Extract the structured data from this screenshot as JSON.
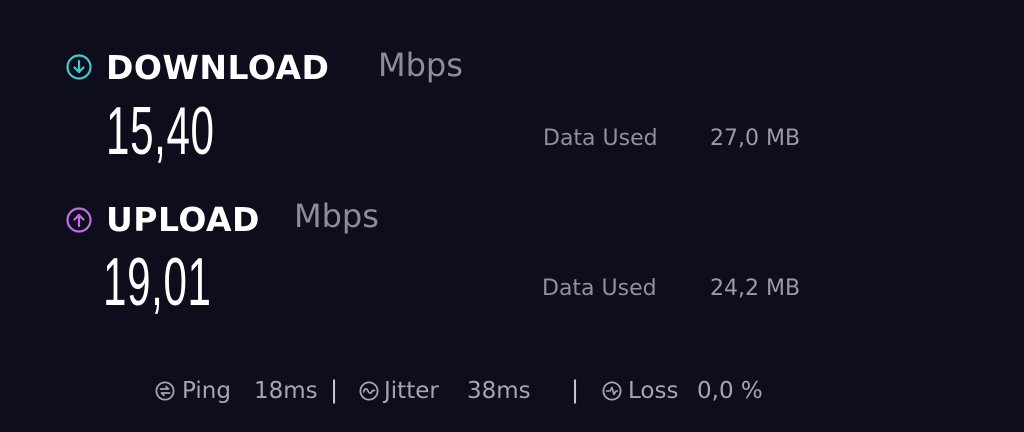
{
  "colors": {
    "background": "#0e0d1c",
    "download_accent": "#45c8cd",
    "upload_accent": "#c06ee6",
    "muted_text": "#8d8c9e"
  },
  "download": {
    "icon": "arrow-down-circle-icon",
    "title": "DOWNLOAD",
    "unit": "Mbps",
    "value": "15,40",
    "data_used_label": "Data Used",
    "data_used_value": "27,0 MB"
  },
  "upload": {
    "icon": "arrow-up-circle-icon",
    "title": "UPLOAD",
    "unit": "Mbps",
    "value": "19,01",
    "data_used_label": "Data Used",
    "data_used_value": "24,2 MB"
  },
  "stats": {
    "ping": {
      "icon": "ping-icon",
      "label": "Ping",
      "value": "18ms"
    },
    "jitter": {
      "icon": "jitter-icon",
      "label": "Jitter",
      "value": "38ms"
    },
    "loss": {
      "icon": "loss-icon",
      "label": "Loss",
      "value": "0,0 %"
    },
    "divider": "|"
  }
}
